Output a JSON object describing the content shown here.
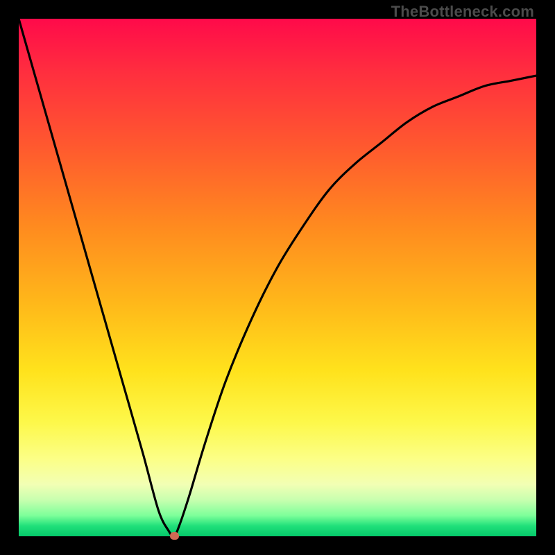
{
  "attribution": "TheBottleneck.com",
  "colors": {
    "page_bg": "#000000",
    "curve_stroke": "#000000",
    "min_marker": "#cf6a54"
  },
  "chart_data": {
    "type": "line",
    "title": "",
    "xlabel": "",
    "ylabel": "",
    "xlim": [
      0,
      100
    ],
    "ylim": [
      0,
      100
    ],
    "grid": false,
    "legend": false,
    "series": [
      {
        "name": "bottleneck-curve",
        "x": [
          0,
          4,
          8,
          12,
          16,
          20,
          24,
          27,
          29,
          30,
          31,
          33,
          36,
          40,
          45,
          50,
          55,
          60,
          65,
          70,
          75,
          80,
          85,
          90,
          95,
          100
        ],
        "values": [
          100,
          86,
          72,
          58,
          44,
          30,
          16,
          5,
          1,
          0,
          2,
          8,
          18,
          30,
          42,
          52,
          60,
          67,
          72,
          76,
          80,
          83,
          85,
          87,
          88,
          89
        ]
      }
    ],
    "minimum": {
      "x": 30,
      "value": 0
    },
    "background_gradient": {
      "top_color": "#ff0a4a",
      "bottom_color": "#05c96b"
    }
  }
}
